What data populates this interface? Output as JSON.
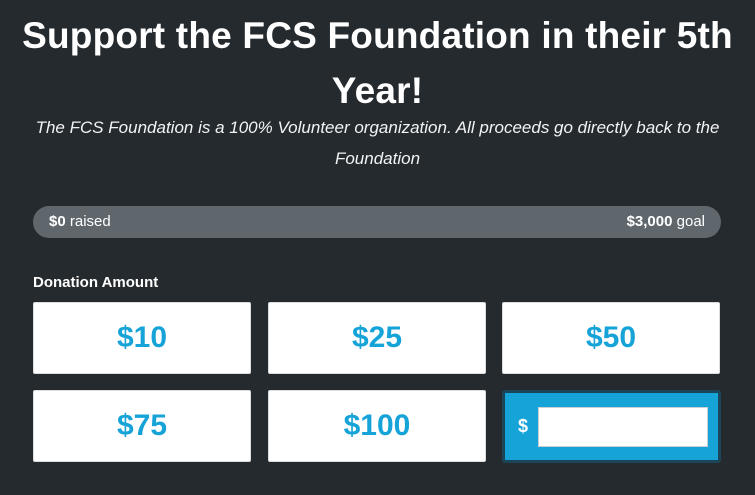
{
  "header": {
    "title": "Support the FCS Foundation in their 5th Year!",
    "subtitle": "The FCS Foundation is a 100% Volunteer organization. All proceeds go directly back to the Foundation"
  },
  "progress": {
    "raised_amount": "$0",
    "raised_label": " raised",
    "goal_amount": "$3,000",
    "goal_label": " goal",
    "fraction": 0
  },
  "donation": {
    "label": "Donation Amount",
    "amounts": [
      "$10",
      "$25",
      "$50",
      "$75",
      "$100"
    ],
    "custom": {
      "currency_symbol": "$",
      "value": "",
      "placeholder": ""
    }
  },
  "colors": {
    "background": "#252a2e",
    "accent": "#16a3d8",
    "progress_track": "#5f676d"
  }
}
